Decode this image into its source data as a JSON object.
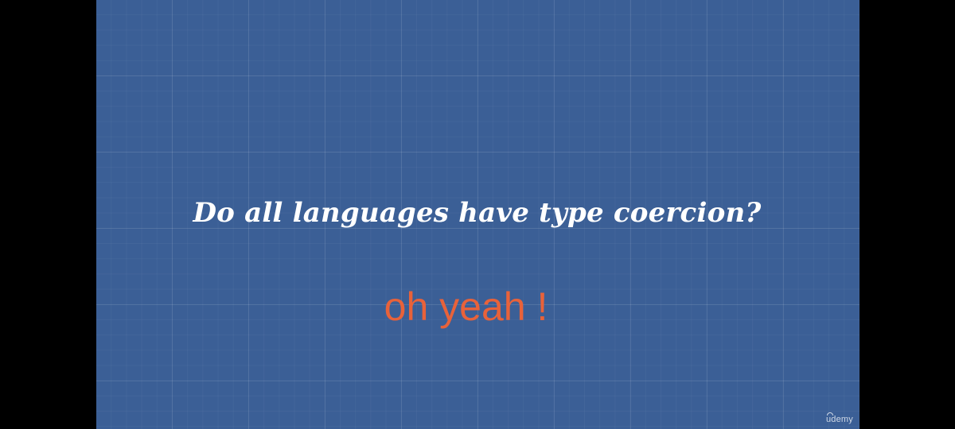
{
  "slide": {
    "question": "Do all languages have type coercion?",
    "answer": "oh yeah !",
    "brand": "udemy"
  },
  "colors": {
    "background": "#3b5f96",
    "question_text": "#ffffff",
    "answer_text": "#e8623a",
    "letterbox": "#000000"
  }
}
